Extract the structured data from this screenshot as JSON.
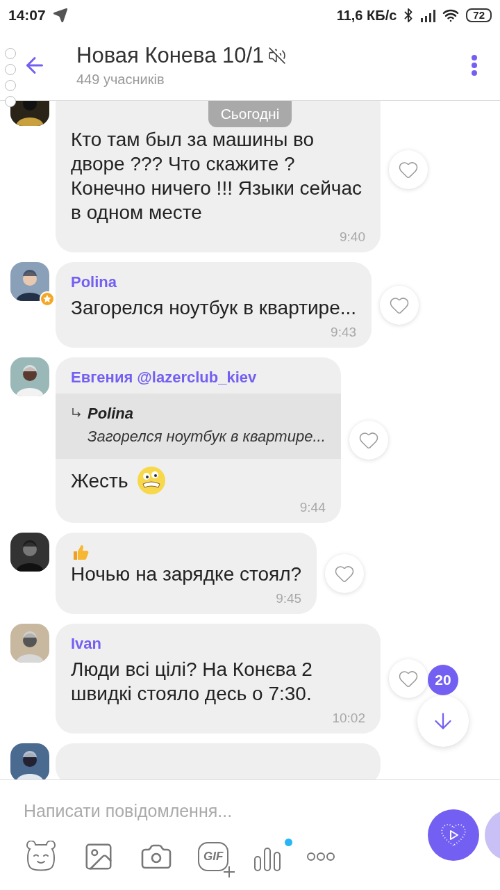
{
  "status_bar": {
    "time": "14:07",
    "speed": "11,6 КБ/с",
    "battery": "72"
  },
  "header": {
    "title": "Новая Конева 10/1",
    "muted": true,
    "subtitle": "449 учасників"
  },
  "date_pill": "Сьогодні",
  "messages": [
    {
      "text": "Кто там был за машины во дворе ??? Что скажите ? Конечно ничего !!! Языки сейчас  в одном месте",
      "time": "9:40",
      "admin": false
    },
    {
      "sender": "Polina",
      "text": "Загорелся ноутбук в квартире...",
      "time": "9:43",
      "admin": true
    },
    {
      "sender": "Евгения @lazerclub_kiev",
      "quote": {
        "sender": "Polina",
        "text": "Загорелся ноутбук в квартире..."
      },
      "text": "Жесть",
      "trailing_emoji": true,
      "time": "9:44",
      "admin": false
    },
    {
      "leading_emoji": true,
      "text": "Ночью на зарядке стоял?",
      "time": "9:45",
      "admin": false
    },
    {
      "sender": "Ivan",
      "text": "Люди всі цілі? На Конєва 2 швидкі стояло десь о 7:30.",
      "time": "10:02",
      "admin": false
    }
  ],
  "scroll_down": {
    "count": "20"
  },
  "composer": {
    "placeholder": "Написати повідомлення...",
    "gif_label": "GIF",
    "new_indicator": true
  }
}
